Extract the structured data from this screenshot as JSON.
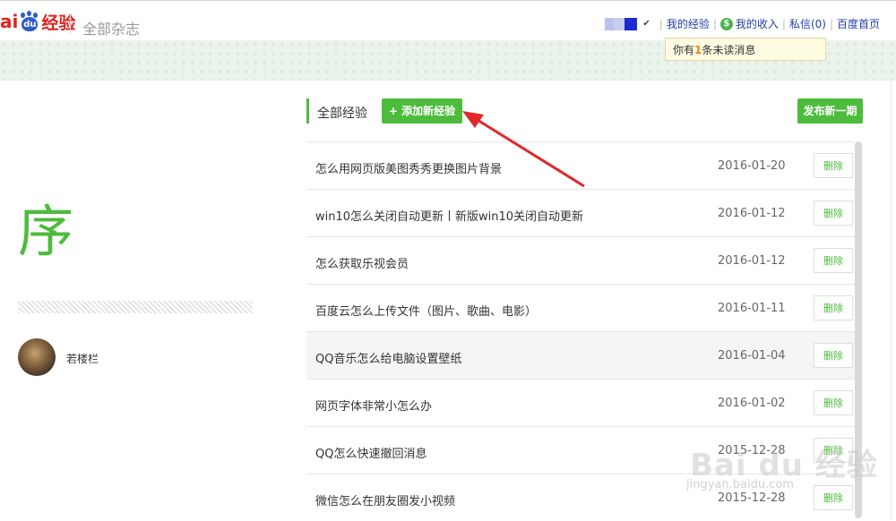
{
  "header": {
    "logo_text": "Baidu经验",
    "logo_ai": "ai",
    "logo_du": "du",
    "logo_jy": "经验",
    "magazine_title": "全部杂志",
    "nav": {
      "my_experience": "我的经验",
      "my_income": "我的收入",
      "messages": "私信(0)",
      "baidu_home": "百度首页"
    },
    "unread_prefix": "你有",
    "unread_count": "1",
    "unread_suffix": "条未读消息"
  },
  "sidebar": {
    "big_char": "序",
    "author_name": "若楼栏"
  },
  "list": {
    "title": "全部经验",
    "add_button": "+ 添加新经验",
    "publish_button": "发布新一期",
    "delete_label": "删除",
    "rows": [
      {
        "title": "怎么用网页版美图秀秀更换图片背景",
        "date": "2016-01-20"
      },
      {
        "title": "win10怎么关闭自动更新丨新版win10关闭自动更新",
        "date": "2016-01-12"
      },
      {
        "title": "怎么获取乐视会员",
        "date": "2016-01-12"
      },
      {
        "title": "百度云怎么上传文件（图片、歌曲、电影）",
        "date": "2016-01-11"
      },
      {
        "title": "QQ音乐怎么给电脑设置壁纸",
        "date": "2016-01-04"
      },
      {
        "title": "网页字体非常小怎么办",
        "date": "2016-01-02"
      },
      {
        "title": "QQ怎么快速撤回消息",
        "date": "2015-12-28"
      },
      {
        "title": "微信怎么在朋友圈发小视频",
        "date": "2015-12-28"
      }
    ]
  },
  "watermark": {
    "main": "Bai du 经验",
    "url": "jingyan.baidu.com"
  },
  "colors": {
    "accent_green": "#4dbb3c",
    "brand_red": "#e1211d",
    "brand_blue": "#2d5bd2",
    "link_blue": "#1f3fa8",
    "annotation_red": "#e02828"
  }
}
